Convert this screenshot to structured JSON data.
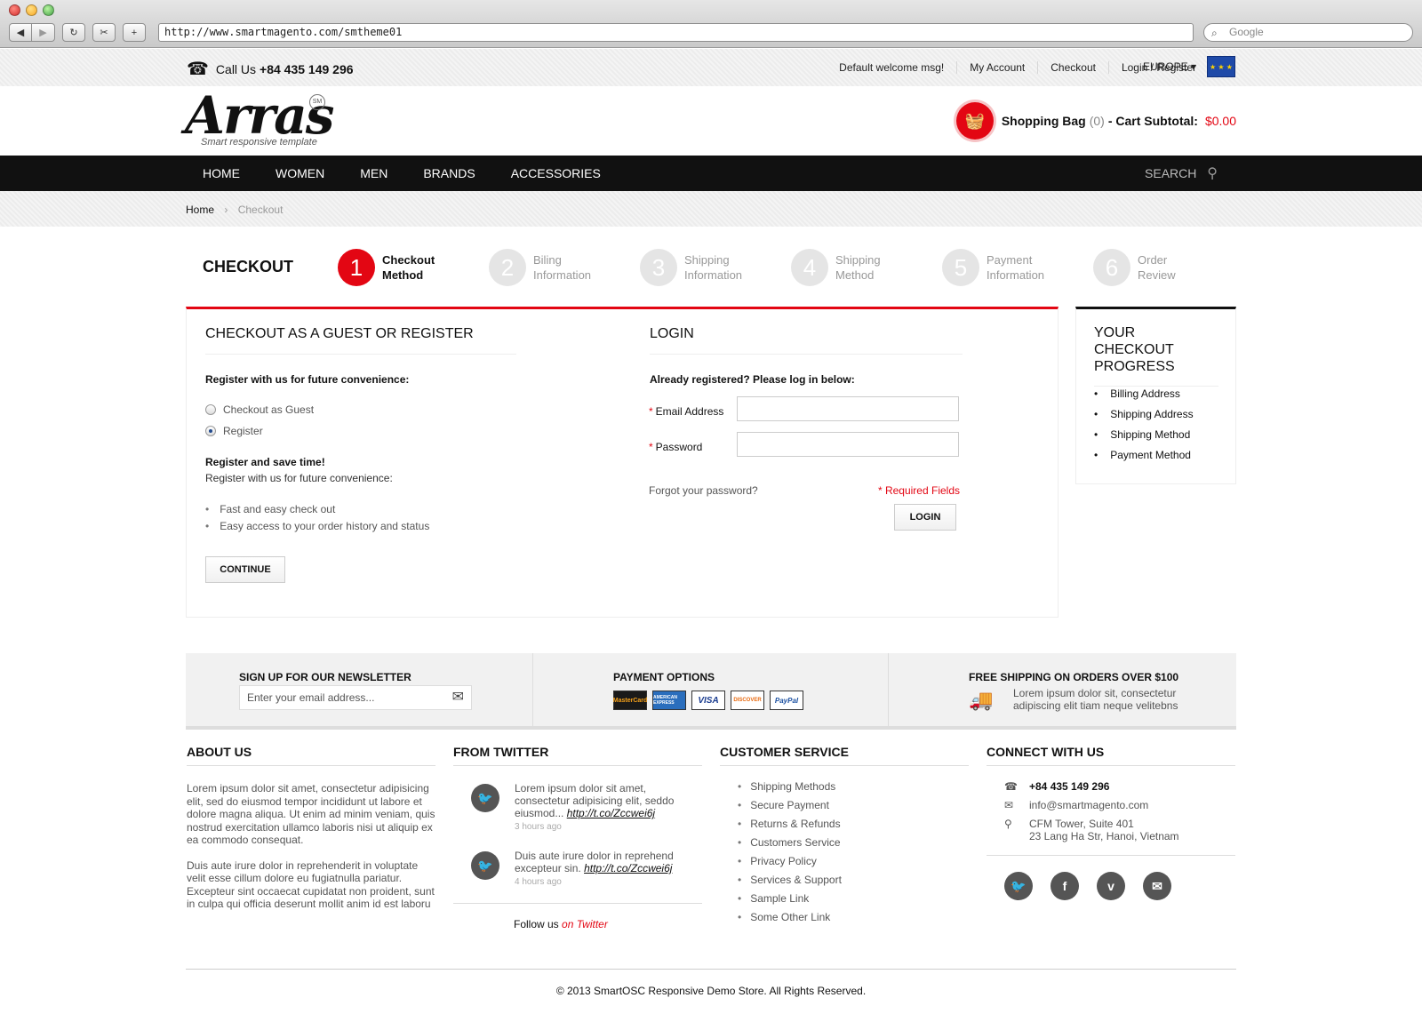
{
  "browser": {
    "url": "http://www.smartmagento.com/smtheme01",
    "search_placeholder": "Google"
  },
  "topbar": {
    "call_label": "Call Us",
    "phone": "+84 435 149 296",
    "links": [
      "Default welcome msg!",
      "My Account",
      "Checkout",
      "Login / Register"
    ],
    "region": "EUROPE ▾"
  },
  "header": {
    "logo": "Arras",
    "logo_badge": "SM",
    "tagline": "Smart responsive template",
    "cart_label": "Shopping Bag",
    "cart_count": "(0)",
    "cart_subtotal_label": "- Cart Subtotal:",
    "cart_subtotal": "$0.00"
  },
  "nav": {
    "items": [
      "HOME",
      "WOMEN",
      "MEN",
      "BRANDS",
      "ACCESSORIES"
    ],
    "search": "SEARCH"
  },
  "breadcrumb": {
    "home": "Home",
    "current": "Checkout"
  },
  "checkout": {
    "title": "CHECKOUT",
    "steps": [
      {
        "num": "1",
        "line1": "Checkout",
        "line2": "Method"
      },
      {
        "num": "2",
        "line1": "Biling",
        "line2": "Information"
      },
      {
        "num": "3",
        "line1": "Shipping",
        "line2": "Information"
      },
      {
        "num": "4",
        "line1": "Shipping",
        "line2": "Method"
      },
      {
        "num": "5",
        "line1": "Payment",
        "line2": "Information"
      },
      {
        "num": "6",
        "line1": "Order",
        "line2": "Review"
      }
    ],
    "guest": {
      "heading": "CHECKOUT AS A GUEST OR REGISTER",
      "prompt": "Register with us for future convenience:",
      "option_guest": "Checkout as Guest",
      "option_register": "Register",
      "save_title": "Register and save time!",
      "save_sub": "Register with us for future convenience:",
      "benefits": [
        "Fast and easy check out",
        "Easy access to your order history and status"
      ],
      "continue": "CONTINUE"
    },
    "login": {
      "heading": "LOGIN",
      "prompt": "Already registered? Please log in below:",
      "email_label": "Email Address",
      "password_label": "Password",
      "forgot": "Forgot your password?",
      "required": "* Required Fields",
      "button": "LOGIN"
    },
    "progress": {
      "title": "YOUR CHECKOUT PROGRESS",
      "items": [
        "Billing Address",
        "Shipping Address",
        "Shipping Method",
        "Payment Method"
      ]
    }
  },
  "footer_strip": {
    "newsletter_title": "SIGN UP FOR OUR NEWSLETTER",
    "newsletter_placeholder": "Enter your email address...",
    "payment_title": "PAYMENT OPTIONS",
    "cards": [
      "MasterCard",
      "AMERICAN EXPRESS",
      "VISA",
      "DISCOVER",
      "PayPal"
    ],
    "shipping_title": "FREE SHIPPING ON ORDERS OVER $100",
    "shipping_line1": "Lorem ipsum dolor sit, consectetur",
    "shipping_line2": "adipiscing elit tiam neque velitebns"
  },
  "footer": {
    "about_title": "ABOUT US",
    "about_p1": "Lorem ipsum dolor sit amet, consectetur adipisicing elit, sed do eiusmod tempor incididunt ut labore et dolore magna aliqua. Ut enim ad minim veniam, quis nostrud exercitation ullamco laboris nisi ut aliquip ex ea commodo consequat.",
    "about_p2": "Duis aute irure dolor in reprehenderit in voluptate velit esse cillum dolore eu fugiatnulla pariatur. Excepteur sint occaecat cupidatat non proident, sunt in culpa qui officia deserunt mollit anim id est laboru",
    "twitter_title": "FROM TWITTER",
    "tweets": [
      {
        "text": "Lorem ipsum dolor sit amet, consectetur adipisicing elit, seddo eiusmod...",
        "link": "http://t.co/Zccwei6j",
        "ago": "3 hours ago"
      },
      {
        "text": "Duis aute irure dolor in reprehend excepteur sin.",
        "link": "http://t.co/Zccwei6j",
        "ago": "4 hours ago"
      }
    ],
    "follow_label": "Follow us",
    "follow_link": "on Twitter",
    "cs_title": "CUSTOMER SERVICE",
    "cs_links": [
      "Shipping Methods",
      "Secure Payment",
      "Returns & Refunds",
      "Customers Service",
      "Privacy Policy",
      "Services & Support",
      "Sample Link",
      "Some Other Link"
    ],
    "connect_title": "CONNECT WITH US",
    "phone": "+84 435 149 296",
    "email": "info@smartmagento.com",
    "address1": "CFM Tower, Suite 401",
    "address2": "23 Lang Ha Str, Hanoi, Vietnam",
    "copyright": "© 2013 SmartOSC Responsive Demo Store. All Rights Reserved."
  }
}
